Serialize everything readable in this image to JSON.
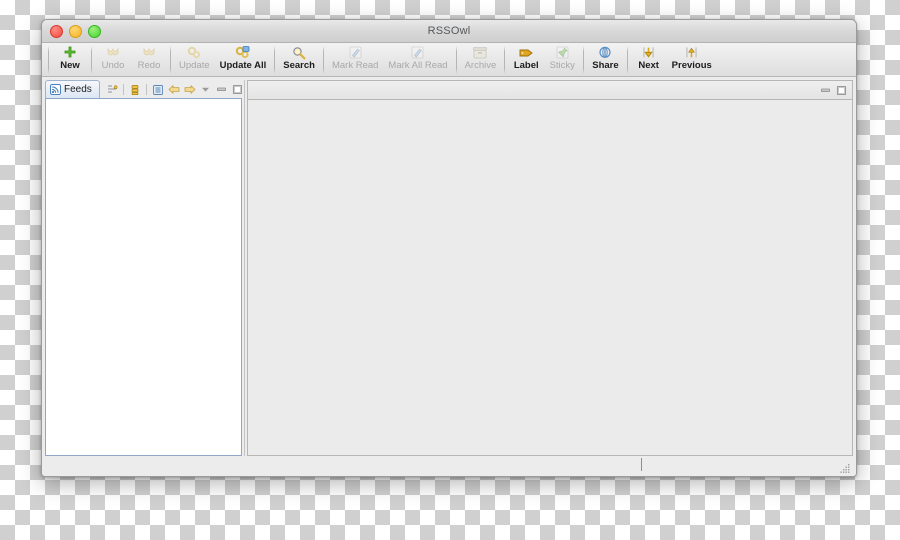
{
  "window": {
    "title": "RSSOwl",
    "traffic_lights": [
      "close-button",
      "minimize-button",
      "zoom-button"
    ]
  },
  "toolbar": {
    "groups": [
      {
        "items": [
          {
            "label": "New",
            "icon": "green-plus-icon",
            "enabled": true,
            "bold": false
          }
        ]
      },
      {
        "items": [
          {
            "label": "Undo",
            "icon": "undo-arrow-icon",
            "enabled": false,
            "bold": false
          },
          {
            "label": "Redo",
            "icon": "redo-arrow-icon",
            "enabled": false,
            "bold": false
          }
        ]
      },
      {
        "items": [
          {
            "label": "Update",
            "icon": "update-icon",
            "enabled": false,
            "bold": false
          },
          {
            "label": "Update All",
            "icon": "update-all-icon",
            "enabled": true,
            "bold": true
          }
        ]
      },
      {
        "items": [
          {
            "label": "Search",
            "icon": "magnifier-icon",
            "enabled": true,
            "bold": true
          }
        ]
      },
      {
        "items": [
          {
            "label": "Mark Read",
            "icon": "pencil-icon",
            "enabled": false,
            "bold": false
          },
          {
            "label": "Mark All Read",
            "icon": "pencil-icon",
            "enabled": false,
            "bold": false
          }
        ]
      },
      {
        "items": [
          {
            "label": "Archive",
            "icon": "archive-box-icon",
            "enabled": false,
            "bold": false
          }
        ]
      },
      {
        "items": [
          {
            "label": "Label",
            "icon": "tag-icon",
            "enabled": true,
            "bold": true
          },
          {
            "label": "Sticky",
            "icon": "pin-icon",
            "enabled": false,
            "bold": false
          }
        ]
      },
      {
        "items": [
          {
            "label": "Share",
            "icon": "share-icon",
            "enabled": true,
            "bold": true
          }
        ]
      },
      {
        "items": [
          {
            "label": "Next",
            "icon": "arrow-down-icon",
            "enabled": true,
            "bold": true
          },
          {
            "label": "Previous",
            "icon": "arrow-up-icon",
            "enabled": true,
            "bold": true
          }
        ]
      }
    ]
  },
  "left_view": {
    "tab": {
      "label": "Feeds",
      "icon": "rss-feed-icon",
      "active": true
    },
    "tools": [
      {
        "name": "link-with-editor-icon"
      },
      {
        "name": "bookmark-filter-icon"
      },
      {
        "name": "collapse-all-icon"
      },
      {
        "name": "back-arrow-icon"
      },
      {
        "name": "forward-arrow-icon"
      },
      {
        "name": "view-menu-icon"
      },
      {
        "name": "minimize-icon"
      },
      {
        "name": "maximize-icon"
      }
    ],
    "tree_items": []
  },
  "editor_area": {
    "tabs": [],
    "tools": [
      {
        "name": "minimize-icon"
      },
      {
        "name": "maximize-icon"
      }
    ],
    "content": ""
  },
  "statusbar": {
    "text": "",
    "caret": "text-caret",
    "grip": "resize-grip"
  },
  "colors": {
    "window_chrome": "#ececec",
    "titlebar": "#d8d8d8",
    "toolbar": "#e7e7e7",
    "tree_background": "#ffffff",
    "tree_border": "#8fa8c8",
    "editor_background": "#ebebeb",
    "tab_active": "#dce6f4",
    "accent_green": "#4aa82e",
    "accent_gold": "#e3b229",
    "accent_blue": "#4a7fbe"
  }
}
